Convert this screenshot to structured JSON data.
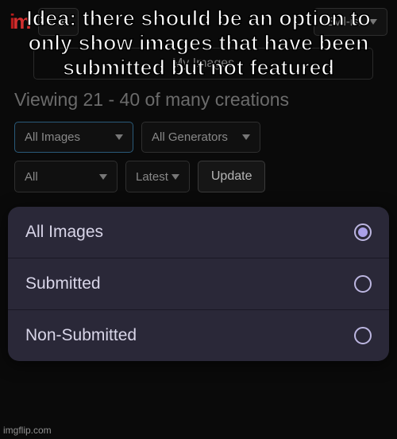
{
  "overlay_text": "Idea: there should be an option to only show images that have been submitted but not featured",
  "topbar": {
    "create_label": "Cre",
    "user_label": ".Evil-isl"
  },
  "my_images_label": "My Images",
  "viewing_text": "Viewing 21 - 40 of many creations",
  "filters": {
    "all_images": "All Images",
    "all_generators": "All Generators",
    "all": "All",
    "latest": "Latest",
    "update": "Update"
  },
  "menu": {
    "items": [
      {
        "label": "All Images",
        "selected": true
      },
      {
        "label": "Submitted",
        "selected": false
      },
      {
        "label": "Non-Submitted",
        "selected": false
      }
    ]
  },
  "watermark": "imgflip.com"
}
